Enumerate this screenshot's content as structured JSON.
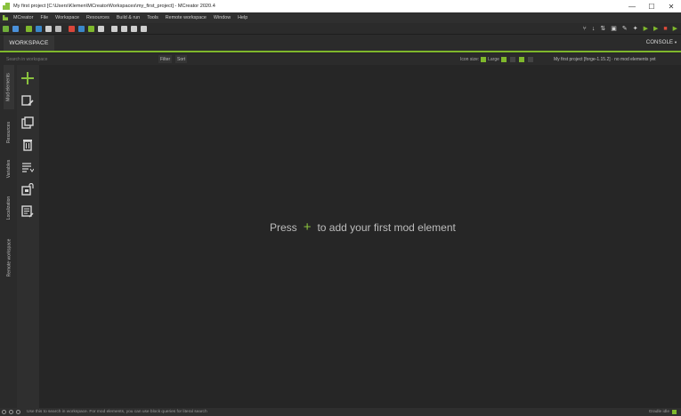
{
  "window": {
    "title": "My first project [C:\\Users\\Klemen\\MCreatorWorkspaces\\my_first_project] - MCreator 2020.4",
    "minimize": "—",
    "maximize": "☐",
    "close": "✕"
  },
  "menu": [
    "MCreator",
    "File",
    "Workspace",
    "Resources",
    "Build & run",
    "Tools",
    "Remote workspace",
    "Window",
    "Help"
  ],
  "toolbar": {
    "left_icons": [
      "#6fae3a",
      "#4a90d9",
      "#7fb82c",
      "#3a87c9",
      "#cfcfcf",
      "#b9b9b9",
      "#d9463a",
      "#3a87c9",
      "#7fb82c",
      "#cfcfcf",
      "#cfcfcf",
      "#cfcfcf",
      "#cfcfcf",
      "#cfcfcf"
    ],
    "right_glyphs": [
      "⑂",
      "↓",
      "⇅",
      "▣",
      "✎",
      "✦",
      "▶",
      "▶",
      "■",
      "▶"
    ]
  },
  "tabs": {
    "workspace": "WORKSPACE",
    "console": "CONSOLE"
  },
  "workspace_bar": {
    "search_placeholder": "Search in workspace",
    "filter": "Filter",
    "sort": "Sort",
    "icon_size_label": "Icon size:",
    "icon_size_value": "Large",
    "project_info": "My first project [forge-1.15.2] · no mod elements yet"
  },
  "side_tabs": [
    "Mod elements",
    "Resources",
    "Variables",
    "Localization",
    "Remote workspace"
  ],
  "actions": [
    "add",
    "edit",
    "duplicate",
    "delete",
    "sort",
    "lock",
    "refactor"
  ],
  "empty_state": {
    "before": "Press",
    "after": "to add your first mod element"
  },
  "status": {
    "hint": "Use this to search in workspace. For mod elements, you can use block queries for literal search",
    "gradle": "Gradle idle"
  },
  "colors": {
    "accent": "#7fb82c",
    "background": "#262626",
    "panel": "#2b2b2b"
  }
}
